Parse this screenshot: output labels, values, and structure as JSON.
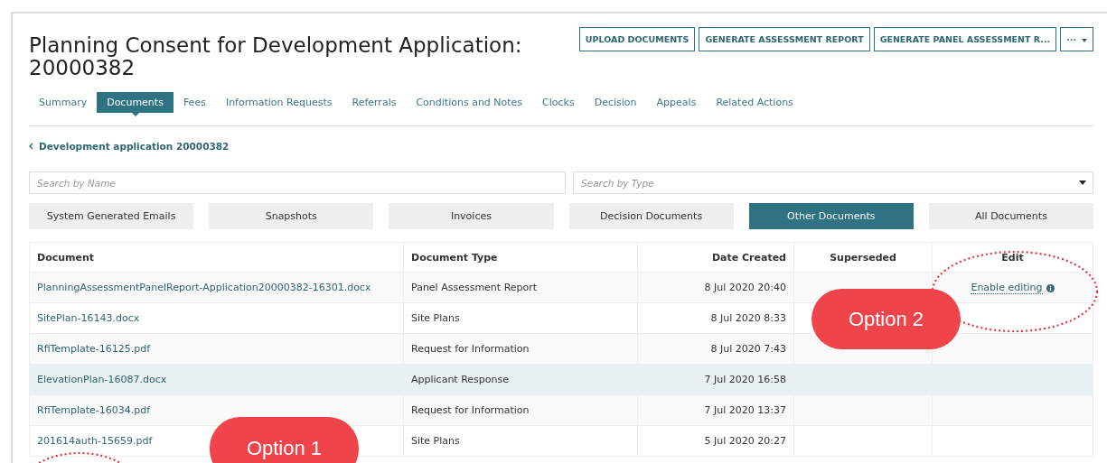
{
  "title": "Planning Consent for Development Application: 20000382",
  "actions": [
    {
      "label": "UPLOAD DOCUMENTS",
      "kind": "text"
    },
    {
      "label": "GENERATE ASSESSMENT REPORT",
      "kind": "text"
    },
    {
      "label": "GENERATE PANEL ASSESSMENT R...",
      "kind": "text"
    },
    {
      "label": "···",
      "kind": "menu"
    }
  ],
  "tabs": [
    {
      "label": "Summary",
      "selected": false
    },
    {
      "label": "Documents",
      "selected": true
    },
    {
      "label": "Fees",
      "selected": false
    },
    {
      "label": "Information Requests",
      "selected": false
    },
    {
      "label": "Referrals",
      "selected": false
    },
    {
      "label": "Conditions and Notes",
      "selected": false
    },
    {
      "label": "Clocks",
      "selected": false
    },
    {
      "label": "Decision",
      "selected": false
    },
    {
      "label": "Appeals",
      "selected": false
    },
    {
      "label": "Related Actions",
      "selected": false
    }
  ],
  "breadcrumb": "Development application 20000382",
  "search_name": {
    "placeholder": "Search by Name"
  },
  "search_type": {
    "placeholder": "Search by Type"
  },
  "filters": [
    {
      "label": "System Generated Emails",
      "selected": false
    },
    {
      "label": "Snapshots",
      "selected": false
    },
    {
      "label": "Invoices",
      "selected": false
    },
    {
      "label": "Decision Documents",
      "selected": false
    },
    {
      "label": "Other Documents",
      "selected": true
    },
    {
      "label": "All Documents",
      "selected": false
    }
  ],
  "table": {
    "columns": [
      "Document",
      "Document Type",
      "Date Created",
      "Superseded",
      "Edit"
    ],
    "rows": [
      {
        "document": "PlanningAssessmentPanelReport-Application20000382-16301.docx",
        "type": "Panel Assessment Report",
        "date": "8 Jul 2020 20:40",
        "edit": "Enable editing",
        "selected": false
      },
      {
        "document": "SitePlan-16143.docx",
        "type": "Site Plans",
        "date": "8 Jul 2020 8:33",
        "selected": false
      },
      {
        "document": "RfiTemplate-16125.pdf",
        "type": "Request for Information",
        "date": "8 Jul 2020 7:43",
        "selected": false
      },
      {
        "document": "ElevationPlan-16087.docx",
        "type": "Applicant Response",
        "date": "7 Jul 2020 16:58",
        "selected": true
      },
      {
        "document": "RfiTemplate-16034.pdf",
        "type": "Request for Information",
        "date": "7 Jul 2020 13:37",
        "selected": false
      },
      {
        "document": "201614auth-15659.pdf",
        "type": "Site Plans",
        "date": "5 Jul 2020 20:27",
        "selected": false
      }
    ]
  },
  "callouts": [
    "Option 1",
    "Option 2"
  ]
}
